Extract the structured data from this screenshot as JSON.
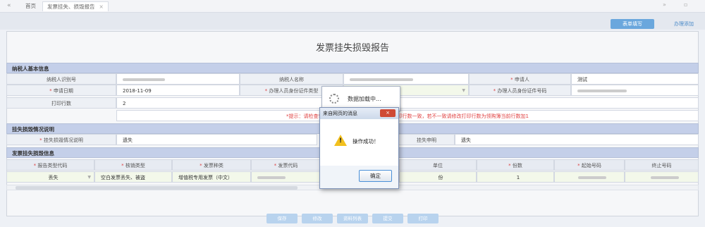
{
  "tabs": {
    "home": "首页",
    "current": "发票挂失、损毁报告",
    "close": "×"
  },
  "nav": {
    "back": "«",
    "forward": "»",
    "restore": "▫"
  },
  "top_buttons": {
    "form": "表单填写",
    "handle": "办理添加"
  },
  "title": "发票挂失损毁报告",
  "taxpayer": {
    "section": "纳税人基本信息",
    "taxpayer_id_label": "纳税人识别号",
    "taxpayer_name_label": "纳税人名称",
    "applicant_label": "申请人",
    "applicant_value": "测试",
    "apply_date_label": "申请日期",
    "apply_date_value": "2018-11-09",
    "id_type_label": "办理人员身份证件类型",
    "id_no_label": "办理人员身份证件号码",
    "print_count_label": "打印行数",
    "print_count_value": "2",
    "hint": "*提示：请检查领购簿打印行数是否与领购簿上的打印行数一致，若不一致请修改打印行数为领购簿当前行数加1",
    "req_mark": "*"
  },
  "loss": {
    "section": "挂失损毁情况说明",
    "desc_label": "挂失损毁情况说明",
    "desc_value": "遗失",
    "statement_label": "挂失申明",
    "statement_value": "遗失"
  },
  "invoice": {
    "section": "发票挂失损毁信息",
    "headers": [
      "报告类型代码",
      "核销类型",
      "发票种类",
      "发票代码",
      "单位",
      "份数",
      "起始号码",
      "终止号码"
    ],
    "row": {
      "report_type": "丢失",
      "cancel_type": "空白发票丢失、被盗",
      "invoice_kind": "增值税专用发票（中文）",
      "unit": "份",
      "count": "1"
    }
  },
  "bottom_buttons": [
    "保存",
    "修改",
    "资料列表",
    "提交",
    "打印"
  ],
  "loading": {
    "text": "数据加载中..."
  },
  "dialog": {
    "title": "来自网页的消息",
    "message": "操作成功！",
    "ok": "确定",
    "close": "×"
  },
  "colors": {
    "section_bg": "#c4cfe9",
    "accent": "#6aa7dd",
    "hint": "#e04040",
    "warn": "#f2c01e"
  }
}
